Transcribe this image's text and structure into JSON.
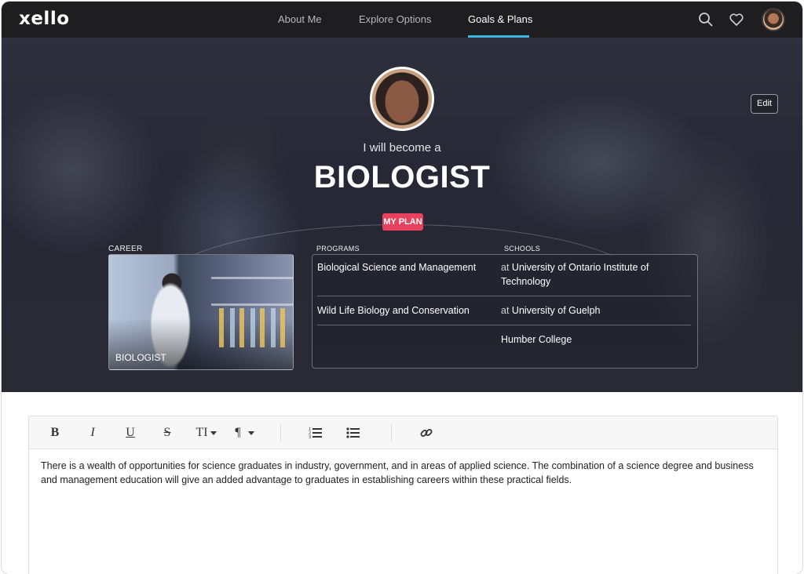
{
  "nav": {
    "logo": "xello",
    "links": [
      "About Me",
      "Explore Options",
      "Goals & Plans"
    ],
    "active_link": "Goals & Plans",
    "icons": [
      "search-icon",
      "heart-icon",
      "avatar"
    ],
    "accent_color": "#3fb4dc"
  },
  "hero": {
    "edit_label": "Edit",
    "subtitle": "I will become a",
    "title": "BIOLOGIST",
    "plan_badge": "MY PLAN",
    "plan_badge_color": "#e8415e",
    "career_heading": "CAREER",
    "programs_heading": "PROGRAMS",
    "schools_heading": "SCHOOLS",
    "career_card_label": "BIOLOGIST",
    "rows": [
      {
        "program": "Biological Science and Management",
        "at": "at",
        "school": "University of Ontario Institute of Technology"
      },
      {
        "program": "Wild Life Biology and Conservation",
        "at": "at",
        "school": "University of Guelph"
      },
      {
        "program": "",
        "at": "",
        "school": "Humber College"
      }
    ]
  },
  "editor": {
    "toolbar": {
      "bold": "B",
      "italic": "I",
      "underline": "U",
      "strike": "S",
      "text_size": "TI",
      "paragraph": "¶",
      "icons": [
        "ordered-list-icon",
        "bullet-list-icon",
        "link-icon"
      ]
    },
    "content": "There is a wealth of opportunities for science graduates in industry, government, and in areas of applied science. The combination of a science degree and business and management education will give an added advantage to graduates in establishing careers within these practical fields."
  }
}
